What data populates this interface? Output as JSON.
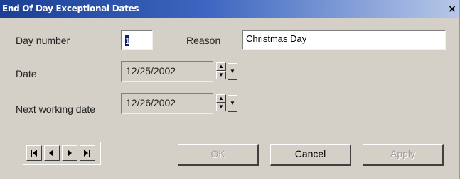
{
  "window": {
    "title": "End Of Day Exceptional Dates"
  },
  "form": {
    "day_number_label": "Day number",
    "day_number_value": "1",
    "reason_label": "Reason",
    "reason_value": "Christmas Day",
    "date_label": "Date",
    "date_value": "12/25/2002",
    "next_working_label": "Next working date",
    "next_working_value": "12/26/2002"
  },
  "buttons": {
    "ok": "OK",
    "cancel": "Cancel",
    "apply": "Apply"
  },
  "nav_icons": [
    "first-record-icon",
    "prev-record-icon",
    "next-record-icon",
    "last-record-icon"
  ]
}
